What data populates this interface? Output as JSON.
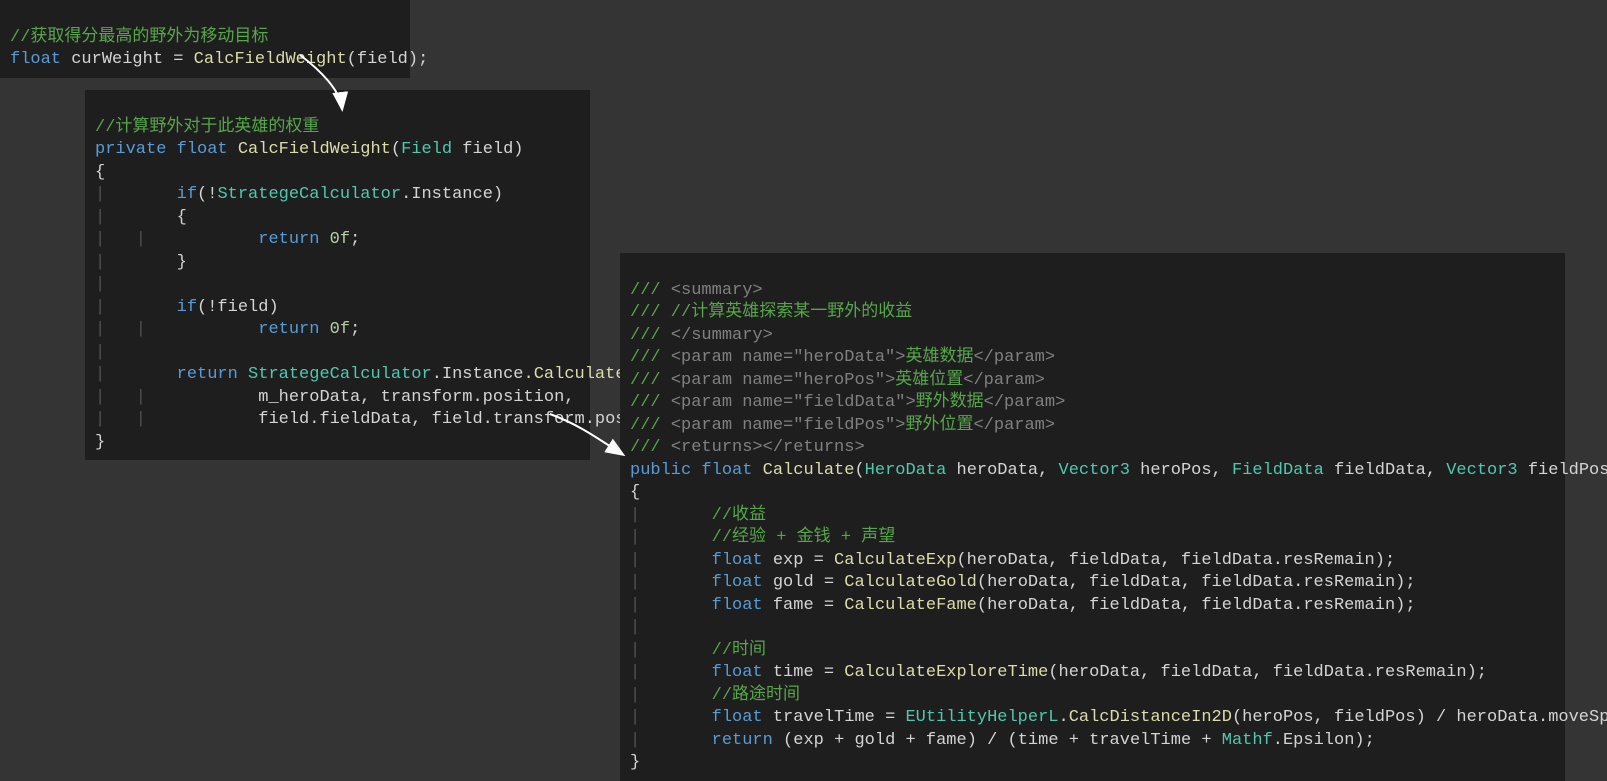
{
  "box1": {
    "c1": "//获取得分最高的野外为移动目标",
    "l2_a": "float",
    "l2_b": " curWeight ",
    "l2_c": "=",
    "l2_d": " CalcFieldWeight",
    "l2_e": "(field);"
  },
  "box2": {
    "c1": "//计算野外对于此英雄的权重",
    "l2_a": "private",
    "l2_b": " float",
    "l2_c": " CalcFieldWeight",
    "l2_d": "(",
    "l2_e": "Field",
    "l2_f": " field)",
    "l3": "{",
    "l4_a": "    if",
    "l4_b": "(!",
    "l4_c": "StrategeCalculator",
    "l4_d": ".Instance)",
    "l5": "    {",
    "l6_a": "        return",
    "l6_b": " 0f",
    "l6_c": ";",
    "l7": "    }",
    "l9_a": "    if",
    "l9_b": "(!field)",
    "l10_a": "        return",
    "l10_b": " 0f",
    "l10_c": ";",
    "l12_a": "    return",
    "l12_b": " StrategeCalculator",
    "l12_c": ".Instance.",
    "l12_d": "Calculate",
    "l12_e": "(",
    "l13": "        m_heroData, transform.position,",
    "l14": "        field.fieldData, field.transform.position);",
    "l15": "}"
  },
  "box3": {
    "d1_a": "/// ",
    "d1_b": "<summary>",
    "d2": "/// //计算英雄探索某一野外的收益",
    "d3_a": "/// ",
    "d3_b": "</summary>",
    "d4_a": "/// ",
    "d4_b": "<param name=",
    "d4_c": "\"heroData\"",
    "d4_d": ">",
    "d4_e": "英雄数据",
    "d4_f": "</param>",
    "d5_c": "\"heroPos\"",
    "d5_e": "英雄位置",
    "d6_c": "\"fieldData\"",
    "d6_e": "野外数据",
    "d7_c": "\"fieldPos\"",
    "d7_e": "野外位置",
    "d8_a": "/// ",
    "d8_b": "<returns></returns>",
    "sig_a": "public",
    "sig_b": " float",
    "sig_c": " Calculate",
    "sig_d": "(",
    "sig_e": "HeroData",
    "sig_f": " heroData, ",
    "sig_g": "Vector3",
    "sig_h": " heroPos, ",
    "sig_i": "FieldData",
    "sig_j": " fieldData, ",
    "sig_k": "Vector3",
    "sig_l": " fieldPos)",
    "lb": "{",
    "c_profit": "    //收益",
    "c_eq": "    //经验 + 金钱 + 声望",
    "exp_a": "    float",
    "exp_b": " exp ",
    "exp_c": "=",
    "exp_d": " CalculateExp",
    "exp_e": "(heroData, fieldData, fieldData.resRemain);",
    "gold_a": "    float",
    "gold_b": " gold ",
    "gold_c": "=",
    "gold_d": " CalculateGold",
    "gold_e": "(heroData, fieldData, fieldData.resRemain);",
    "fame_a": "    float",
    "fame_b": " fame ",
    "fame_c": "=",
    "fame_d": " CalculateFame",
    "fame_e": "(heroData, fieldData, fieldData.resRemain);",
    "c_time": "    //时间",
    "time_a": "    float",
    "time_b": " time ",
    "time_c": "=",
    "time_d": " CalculateExploreTime",
    "time_e": "(heroData, fieldData, fieldData.resRemain);",
    "c_travel": "    //路途时间",
    "trav_a": "    float",
    "trav_b": " travelTime ",
    "trav_c": "=",
    "trav_d": " EUtilityHelperL",
    "trav_e": ".",
    "trav_f": "CalcDistanceIn2D",
    "trav_g": "(heroPos, fieldPos) ",
    "trav_h": "/",
    "trav_i": " heroData.moveSpeed;",
    "ret_a": "    return",
    "ret_b": " (exp ",
    "ret_c": "+",
    "ret_d": " gold ",
    "ret_e": "+",
    "ret_f": " fame) ",
    "ret_g": "/",
    "ret_h": " (time ",
    "ret_i": "+",
    "ret_j": " travelTime ",
    "ret_k": "+",
    "ret_l": " Mathf",
    "ret_m": ".Epsilon);",
    "rb": "}"
  }
}
